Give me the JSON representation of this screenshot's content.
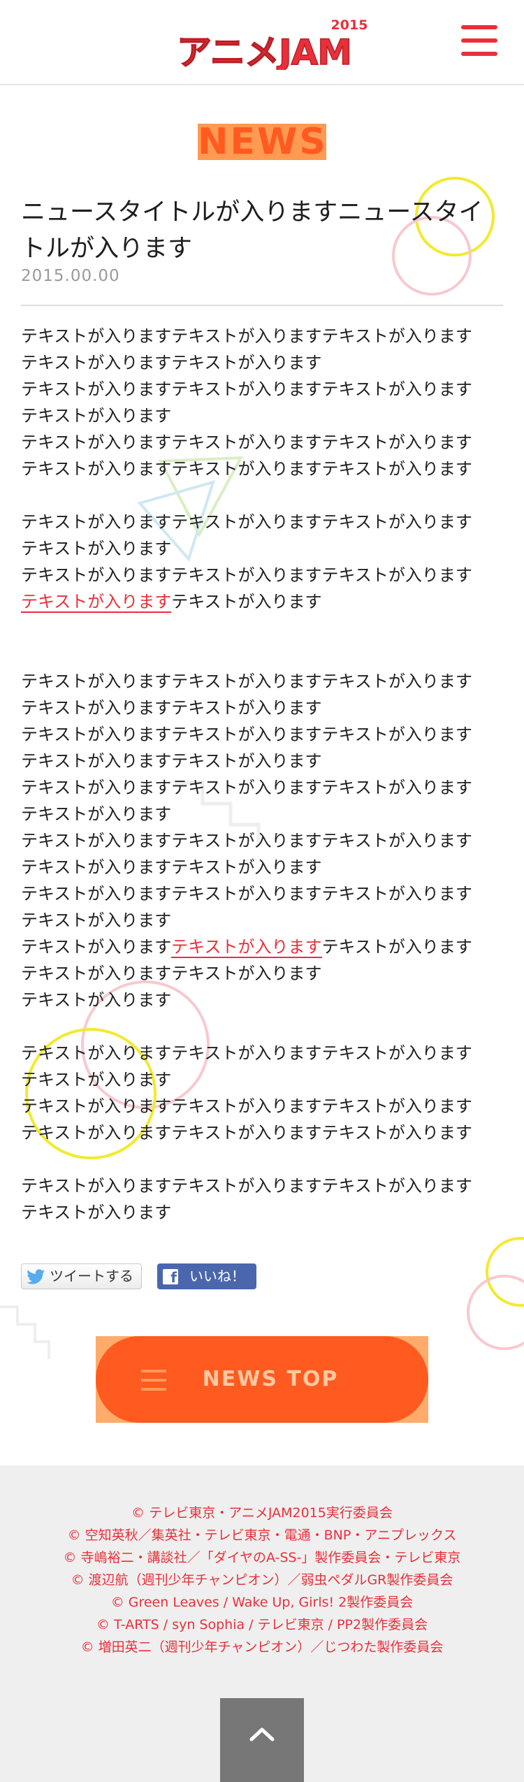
{
  "header": {
    "logo_text": "アニメJAM",
    "logo_year": "2015",
    "menu_icon": "hamburger-menu-icon"
  },
  "article": {
    "section_heading": "NEWS",
    "title": "ニュースタイトルが入りますニュースタイトルが入ります",
    "date": "2015.00.00",
    "paragraphs": [
      [
        "テキストが入りますテキストが入りますテキストが入ります",
        "テキストが入りますテキストが入ります",
        "テキストが入りますテキストが入りますテキストが入ります",
        "テキストが入ります",
        "テキストが入りますテキストが入りますテキストが入ります",
        "テキストが入りますテキストが入りますテキストが入ります"
      ],
      [
        "テキストが入りますテキストが入りますテキストが入ります",
        "テキストが入ります",
        "テキストが入りますテキストが入りますテキストが入ります"
      ],
      [
        "テキストが入りますテキストが入りますテキストが入ります",
        "テキストが入りますテキストが入ります",
        "テキストが入りますテキストが入りますテキストが入ります",
        "テキストが入りますテキストが入ります",
        "テキストが入りますテキストが入りますテキストが入ります",
        "テキストが入ります",
        "テキストが入りますテキストが入りますテキストが入ります",
        "テキストが入りますテキストが入ります",
        "テキストが入りますテキストが入りますテキストが入ります",
        "テキストが入ります"
      ],
      [
        "テキストが入りますテキストが入ります",
        "テキストが入ります"
      ],
      [
        "テキストが入りますテキストが入りますテキストが入ります",
        "テキストが入ります",
        "テキストが入りますテキストが入りますテキストが入ります",
        "テキストが入りますテキストが入りますテキストが入ります"
      ],
      [
        "テキストが入りますテキストが入りますテキストが入ります",
        "テキストが入ります"
      ]
    ],
    "link_text": "テキストが入ります",
    "link_line_suffix": "テキストが入ります",
    "link_line2_prefix": "テキストが入ります",
    "link_line2_suffix": "テキストが入ります"
  },
  "share": {
    "tweet_label": "ツイートする",
    "like_label": "いいね！",
    "like_icon_letter": "f"
  },
  "news_top": {
    "label": "NEWS TOP"
  },
  "footer": {
    "credits": [
      "© テレビ東京・アニメJAM2015実行委員会",
      "© 空知英秋／集英社・テレビ東京・電通・BNP・アニプレックス",
      "© 寺嶋裕二・講談社／「ダイヤのA-SS-」製作委員会・テレビ東京",
      "© 渡辺航（週刊少年チャンピオン）／弱虫ペダルGR製作委員会",
      "© Green Leaves / Wake Up, Girls! 2製作委員会",
      "© T-ARTS / syn Sophia / テレビ東京 / PP2製作委員会",
      "© 増田英二（週刊少年チャンピオン）／じつわた製作委員会"
    ]
  },
  "colors": {
    "brand_red": "#e8303a",
    "orange": "#ff5a1f",
    "light_orange": "#ff9a52",
    "yellow": "#f2ea2e",
    "pink": "#f7c9cf",
    "footer_bg": "#efefef"
  }
}
